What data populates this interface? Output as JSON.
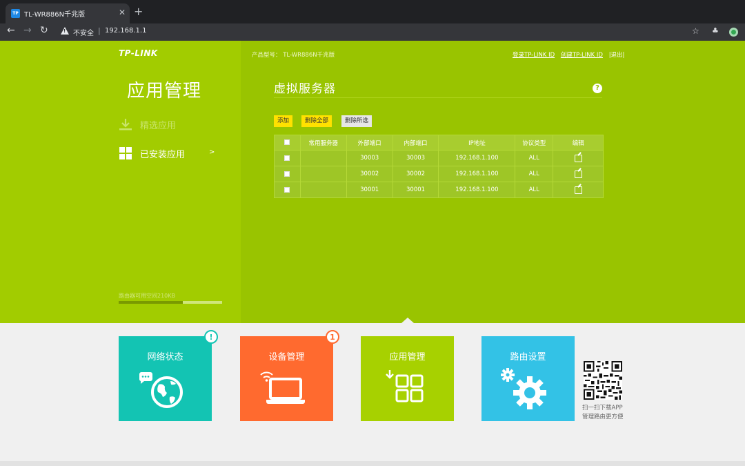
{
  "browser": {
    "tab_title": "TL-WR886N千兆版",
    "favicon_text": "TP",
    "security_label": "不安全",
    "separator": "|",
    "url": "192.168.1.1"
  },
  "header": {
    "logo": "TP-LINK",
    "product_model": "产品型号： TL-WR886N千兆版",
    "links": [
      "登录TP-LINK ID",
      "创建TP-LINK ID",
      "|退出|"
    ]
  },
  "sidebar": {
    "title": "应用管理",
    "items": [
      {
        "label": "精选应用"
      },
      {
        "label": "已安装应用",
        "chevron": ">"
      }
    ],
    "storage_label": "路由器可用空间210KB",
    "storage_used_fraction": 0.62
  },
  "main": {
    "title": "虚拟服务器",
    "help": "?",
    "buttons": [
      "添加",
      "删除全部",
      "删除所选"
    ],
    "table": {
      "headers": [
        "常用服务器",
        "外部端口",
        "内部端口",
        "IP地址",
        "协议类型",
        "编辑"
      ],
      "rows": [
        {
          "service": "",
          "ext_port": "30003",
          "int_port": "30003",
          "ip": "192.168.1.100",
          "protocol": "ALL"
        },
        {
          "service": "",
          "ext_port": "30002",
          "int_port": "30002",
          "ip": "192.168.1.100",
          "protocol": "ALL"
        },
        {
          "service": "",
          "ext_port": "30001",
          "int_port": "30001",
          "ip": "192.168.1.100",
          "protocol": "ALL"
        }
      ]
    }
  },
  "tiles": [
    {
      "label": "网络状态",
      "badge": "!",
      "color": "#13c4b3",
      "icon": "globe-chat-icon"
    },
    {
      "label": "设备管理",
      "badge": "1",
      "color": "#ff6a2f",
      "icon": "laptop-wifi-icon"
    },
    {
      "label": "应用管理",
      "badge": "",
      "color": "#a7d100",
      "icon": "apps-download-icon"
    },
    {
      "label": "路由设置",
      "badge": "",
      "color": "#33c2e6",
      "icon": "gears-icon"
    }
  ],
  "qr": {
    "caption_line1": "扫一扫下载APP",
    "caption_line2": "管理路由更方便"
  }
}
